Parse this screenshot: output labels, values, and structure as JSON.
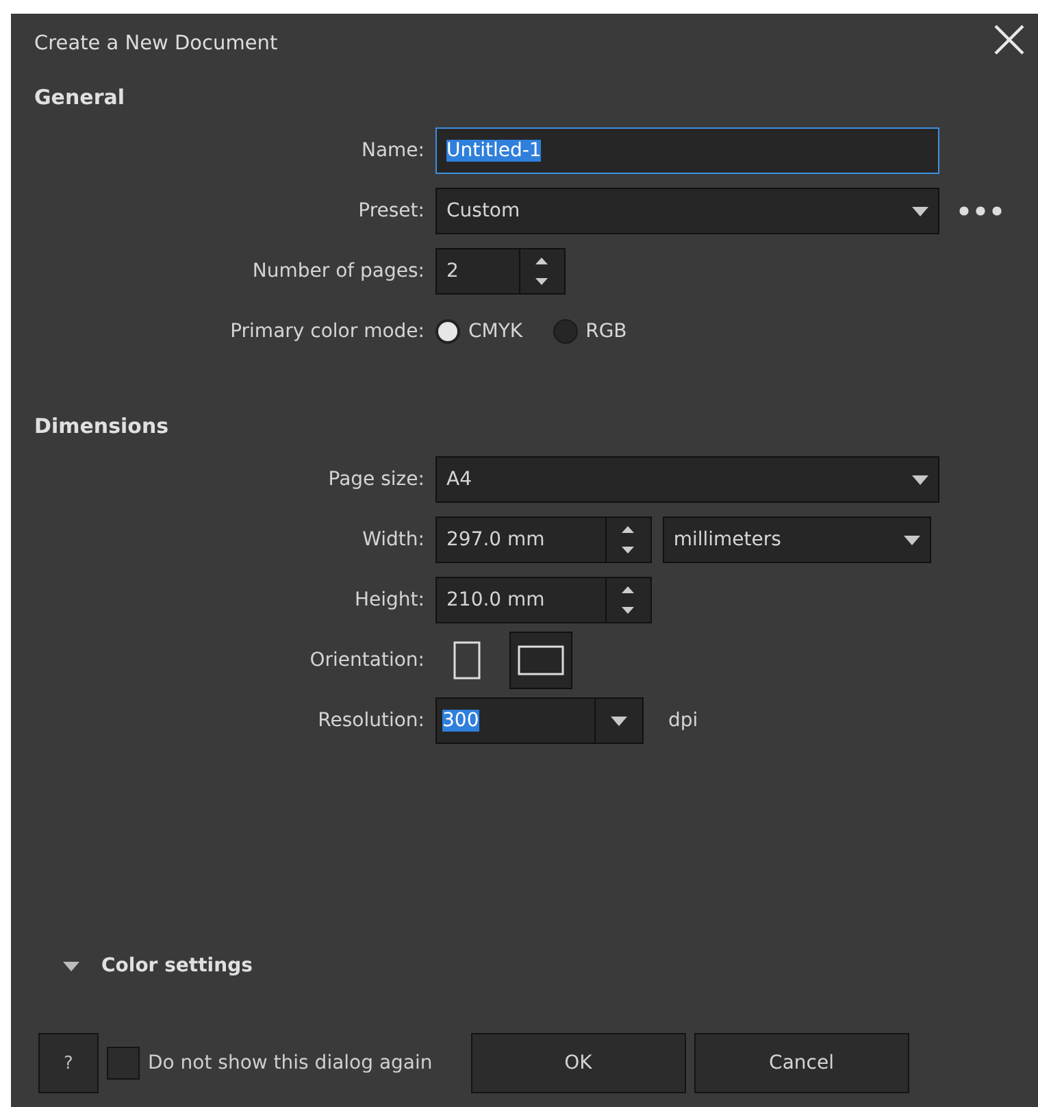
{
  "window": {
    "title": "Create a New Document"
  },
  "sections": [
    {
      "heading": "General",
      "rows": [
        {
          "kind": "text",
          "label": "Name:",
          "value": "Untitled-1",
          "text_selected": true,
          "focused": true
        },
        {
          "kind": "dropdown",
          "label": "Preset:",
          "value": "Custom",
          "more": true
        },
        {
          "kind": "spinner",
          "label": "Number of pages:",
          "value": "2"
        },
        {
          "kind": "radio",
          "label": "Primary color mode:",
          "options": [
            {
              "label": "CMYK",
              "selected": true
            },
            {
              "label": "RGB",
              "selected": false
            }
          ]
        }
      ]
    },
    {
      "heading": "Dimensions",
      "rows": [
        {
          "kind": "dropdown",
          "label": "Page size:",
          "value": "A4",
          "more": false
        },
        {
          "kind": "spinner",
          "label": "Width:",
          "value": "297.0 mm",
          "unit": "millimeters"
        },
        {
          "kind": "spinner",
          "label": "Height:",
          "value": "210.0 mm"
        },
        {
          "kind": "orientation",
          "label": "Orientation:",
          "options": [
            {
              "kind": "portrait",
              "selected": false
            },
            {
              "kind": "landscape",
              "selected": true
            }
          ]
        },
        {
          "kind": "combo",
          "label": "Resolution:",
          "value": "300",
          "text_selected": true,
          "suffix": "dpi"
        }
      ]
    }
  ],
  "color_settings": {
    "label": "Color settings",
    "expanded": false
  },
  "footer": {
    "help": "?",
    "checkbox": {
      "label": "Do not show this dialog again",
      "checked": false
    },
    "buttons": [
      "OK",
      "Cancel"
    ]
  }
}
